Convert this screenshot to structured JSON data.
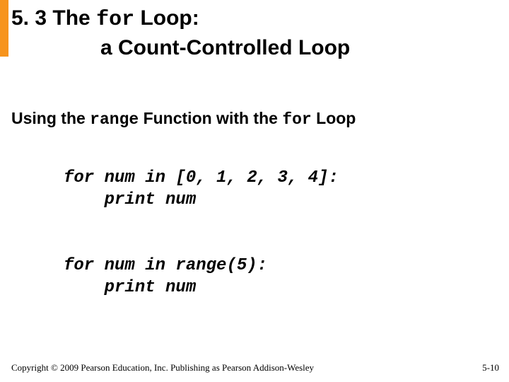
{
  "title": {
    "section_number": "5. 3",
    "pre": "The",
    "code": "for",
    "post": "Loop:",
    "line2": "a Count-Controlled Loop"
  },
  "subtitle": {
    "pre": "Using the",
    "code1": "range",
    "mid": "Function with the",
    "code2": "for",
    "post": "Loop"
  },
  "code_example_1": "for num in [0, 1, 2, 3, 4]:\n    print num",
  "code_example_2": "for num in range(5):\n    print num",
  "footer": {
    "copyright": "Copyright © 2009 Pearson Education, Inc. Publishing as Pearson Addison-Wesley",
    "page_number": "5-10"
  }
}
